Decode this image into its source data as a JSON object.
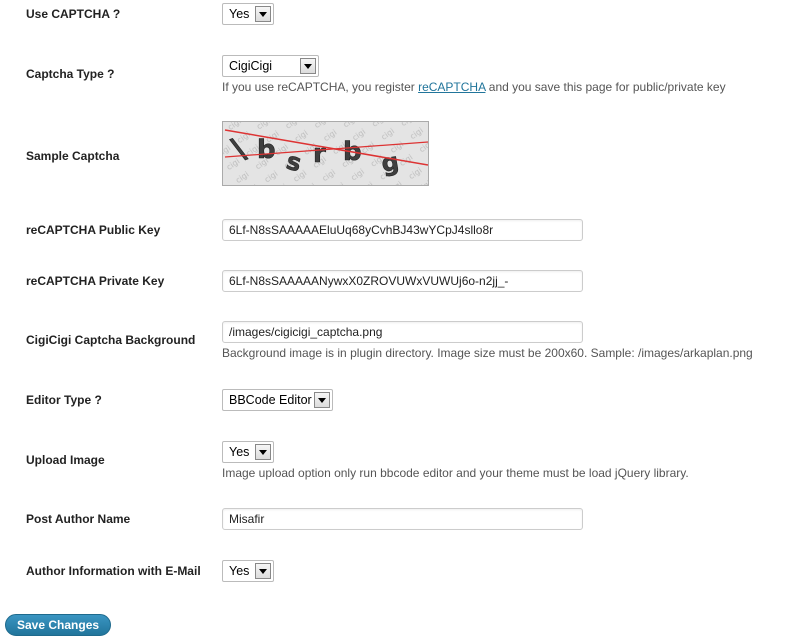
{
  "fields": {
    "use_captcha": {
      "label": "Use CAPTCHA ?",
      "value": "Yes"
    },
    "captcha_type": {
      "label": "Captcha Type ?",
      "value": "CigiCigi",
      "desc_before": "If you use reCAPTCHA, you register ",
      "desc_link": "reCAPTCHA",
      "desc_after": " and you save this page for public/private key"
    },
    "sample_captcha": {
      "label": "Sample Captcha"
    },
    "public_key": {
      "label": "reCAPTCHA Public Key",
      "value": "6Lf-N8sSAAAAAEluUq68yCvhBJ43wYCpJ4sllo8r"
    },
    "private_key": {
      "label": "reCAPTCHA Private Key",
      "value": "6Lf-N8sSAAAAANywxX0ZROVUWxVUWUj6o-n2jj_-"
    },
    "captcha_background": {
      "label": "CigiCigi Captcha Background",
      "value": "/images/cigicigi_captcha.png",
      "desc": "Background image is in plugin directory. Image size must be 200x60. Sample: /images/arkaplan.png"
    },
    "editor_type": {
      "label": "Editor Type ?",
      "value": "BBCode Editor"
    },
    "upload_image": {
      "label": "Upload Image",
      "value": "Yes",
      "desc": "Image upload option only run bbcode editor and your theme must be load jQuery library."
    },
    "post_author_name": {
      "label": "Post Author Name",
      "value": "Misafir"
    },
    "author_info_email": {
      "label": "Author Information with E-Mail",
      "value": "Yes"
    }
  },
  "save_button": "Save Changes",
  "colors": {
    "link": "#21759b",
    "button": "#21759b"
  }
}
